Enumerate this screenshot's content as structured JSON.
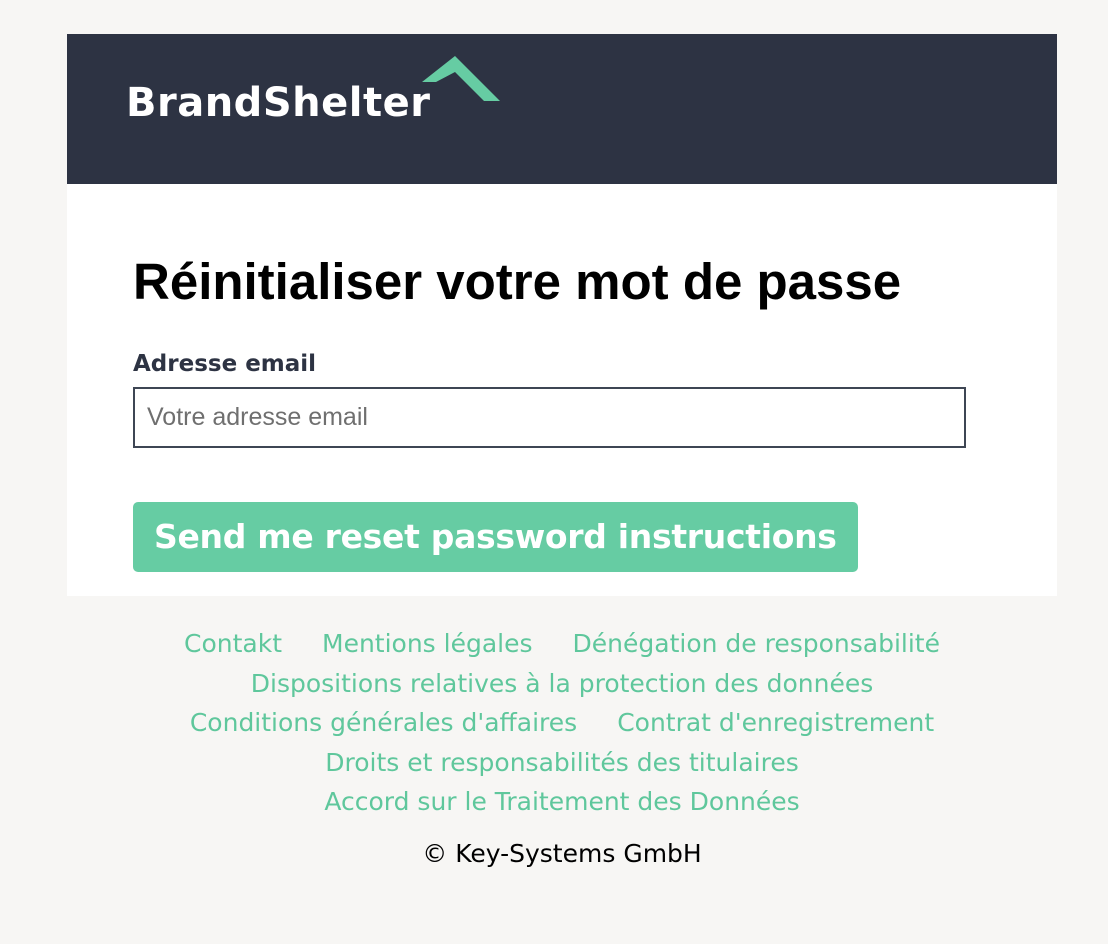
{
  "brand": {
    "name": "BrandShelter",
    "colors": {
      "header_bg": "#2d3343",
      "accent": "#66cca3",
      "link": "#5fc79c",
      "page_bg": "#f7f6f4"
    }
  },
  "form": {
    "title": "Réinitialiser votre mot de passe",
    "email_label": "Adresse email",
    "email_placeholder": "Votre adresse email",
    "email_value": "",
    "submit_label": "Send me reset password instructions"
  },
  "footer": {
    "links": {
      "contakt": "Contakt",
      "mentions": "Mentions légales",
      "denegation": "Dénégation de responsabilité",
      "dispositions": "Dispositions relatives à la protection des données",
      "conditions": "Conditions générales d'affaires",
      "contrat": "Contrat d'enregistrement",
      "droits": "Droits et responsabilités des titulaires",
      "accord": "Accord sur le Traitement des Données"
    },
    "copyright": "© Key-Systems GmbH"
  }
}
